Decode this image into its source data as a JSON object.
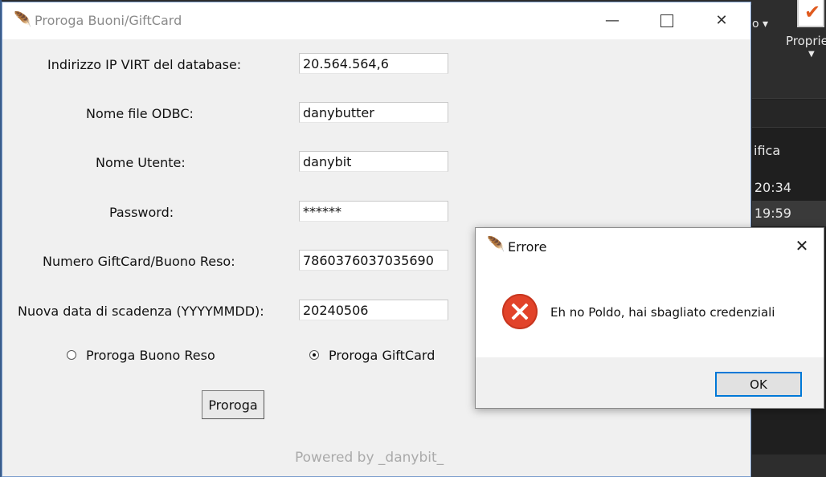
{
  "background": {
    "ribbon_label_o": "o",
    "ribbon_properties": "Proprie",
    "panel_text": "ifica",
    "times": [
      "- 20:34",
      "- 19:59"
    ]
  },
  "main_window": {
    "title": "Proroga Buoni/GiftCard",
    "fields": [
      {
        "label": "Indirizzo IP VIRT del database:",
        "value": "20.564.564,6"
      },
      {
        "label": "Nome file ODBC:",
        "value": "danybutter"
      },
      {
        "label": "Nome Utente:",
        "value": "danybit"
      },
      {
        "label": "Password:",
        "value": "******"
      },
      {
        "label": "Numero GiftCard/Buono Reso:",
        "value": "7860376037035690"
      },
      {
        "label": "Nuova data di scadenza (YYYYMMDD):",
        "value": "20240506"
      }
    ],
    "radio_options": [
      {
        "label": "Proroga Buono Reso",
        "selected": false
      },
      {
        "label": "Proroga GiftCard",
        "selected": true
      }
    ],
    "action_button": "Proroga",
    "footer_text": "Powered by _danybit_",
    "icons": {
      "app": "feather-icon",
      "minimize": "minimize-icon",
      "maximize": "maximize-icon",
      "close": "close-icon"
    }
  },
  "error_dialog": {
    "title": "Errore",
    "message": "Eh no Poldo, hai sbagliato credenziali",
    "ok_label": "OK",
    "icon": "error-icon",
    "accent_color": "#0078d7",
    "error_color": "#e2432a"
  }
}
